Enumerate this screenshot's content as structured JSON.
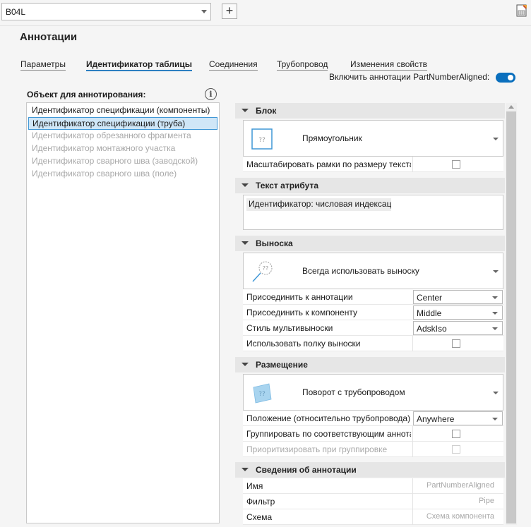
{
  "toolbar": {
    "selector_value": "B04L",
    "add_label": "+",
    "export_icon": "excel-export-icon"
  },
  "page": {
    "title": "Аннотации"
  },
  "tabs": [
    {
      "label": "Параметры",
      "active": false
    },
    {
      "label": "Идентификатор таблицы",
      "active": true
    },
    {
      "label": "Соединения",
      "active": false
    },
    {
      "label": "Трубопровод",
      "active": false
    },
    {
      "label": "Изменения свойств",
      "active": false
    }
  ],
  "toggle": {
    "label": "Включить аннотации PartNumberAligned:",
    "on": true
  },
  "objects": {
    "label": "Объект для аннотирования:",
    "info_icon": "info-icon",
    "info_glyph": "i",
    "items": [
      {
        "label": "Идентификатор спецификации (компоненты)",
        "state": "normal"
      },
      {
        "label": "Идентификатор спецификации (труба)",
        "state": "selected"
      },
      {
        "label": "Идентификатор обрезанного фрагмента",
        "state": "disabled"
      },
      {
        "label": "Идентификатор монтажного участка",
        "state": "disabled"
      },
      {
        "label": "Идентификатор сварного шва (заводской)",
        "state": "disabled"
      },
      {
        "label": "Идентификатор сварного шва (поле)",
        "state": "disabled"
      }
    ]
  },
  "block": {
    "header": "Блок",
    "style": "Прямоугольник",
    "placeholder_glyph": "??",
    "scale_label": "Масштабировать рамки по размеру текста",
    "scale_checked": false
  },
  "attribute_text": {
    "header": "Текст атрибута",
    "value": "Идентификатор: числовая индексация"
  },
  "leader": {
    "header": "Выноска",
    "style": "Всегда использовать выноску",
    "placeholder_glyph": "??",
    "rows": [
      {
        "label": "Присоединить к аннотации",
        "value": "Center"
      },
      {
        "label": "Присоединить к компоненту",
        "value": "Middle"
      },
      {
        "label": "Стиль мультивыноски",
        "value": "AdskIso"
      }
    ],
    "shelf_label": "Использовать полку выноски",
    "shelf_checked": false
  },
  "placement": {
    "header": "Размещение",
    "style": "Поворот с трубопроводом",
    "placeholder_glyph": "??",
    "position_label": "Положение (относительно трубопровода)",
    "position_value": "Anywhere",
    "group_label": "Группировать по соответствующим аннотациям",
    "group_checked": false,
    "prioritize_label": "Приоритизировать при группировке",
    "prioritize_checked": false
  },
  "info": {
    "header": "Сведения об аннотации",
    "rows": [
      {
        "label": "Имя",
        "value": "PartNumberAligned"
      },
      {
        "label": "Фильтр",
        "value": "Pipe"
      },
      {
        "label": "Схема",
        "value": "Схема компонента"
      }
    ]
  }
}
